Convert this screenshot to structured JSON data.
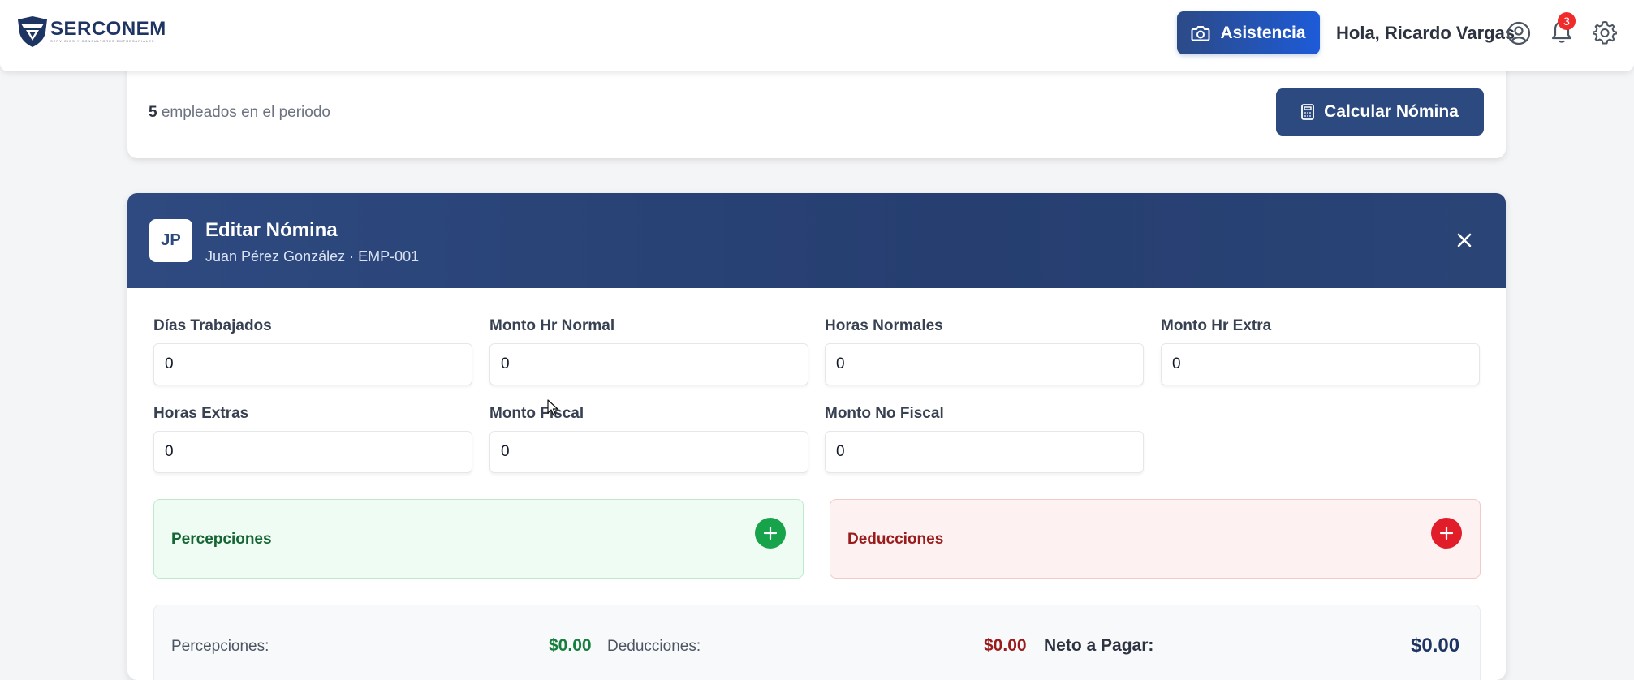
{
  "navbar": {
    "logo_name": "SERCONEM",
    "logo_tagline": "SERVICIOS Y CONSULTORES EMPRESARIALES",
    "asistencia_label": "Asistencia",
    "greeting": "Hola, Ricardo Vargas",
    "notification_count": "3",
    "icons": [
      "shield-logo-icon",
      "camera-icon",
      "user-circle-icon",
      "bell-icon",
      "gear-icon"
    ]
  },
  "period": {
    "employee_count": "5",
    "employee_text": " empleados en el periodo",
    "calc_label": "Calcular Nómina"
  },
  "edit": {
    "avatar_initials": "JP",
    "title": "Editar Nómina",
    "subtitle": "Juan Pérez González · EMP-001",
    "fields": [
      {
        "label": "Días Trabajados",
        "value": "0"
      },
      {
        "label": "Monto Hr Normal",
        "value": "0"
      },
      {
        "label": "Horas Normales",
        "value": "0"
      },
      {
        "label": "Monto Hr Extra",
        "value": "0"
      },
      {
        "label": "Horas Extras",
        "value": "0"
      },
      {
        "label": "Monto Fiscal",
        "value": "0"
      },
      {
        "label": "Monto No Fiscal",
        "value": "0"
      }
    ],
    "percepciones_title": "Percepciones",
    "deducciones_title": "Deducciones",
    "summary": {
      "percepciones_label": "Percepciones:",
      "percepciones_value": "$0.00",
      "deducciones_label": "Deducciones:",
      "deducciones_value": "$0.00",
      "neto_label": "Neto a Pagar:",
      "neto_value": "$0.00"
    }
  },
  "colors": {
    "brand_navy": "#2c4a80",
    "accent_blue": "#1d5bd8",
    "green": "#16a34a",
    "red": "#e11d2a"
  }
}
